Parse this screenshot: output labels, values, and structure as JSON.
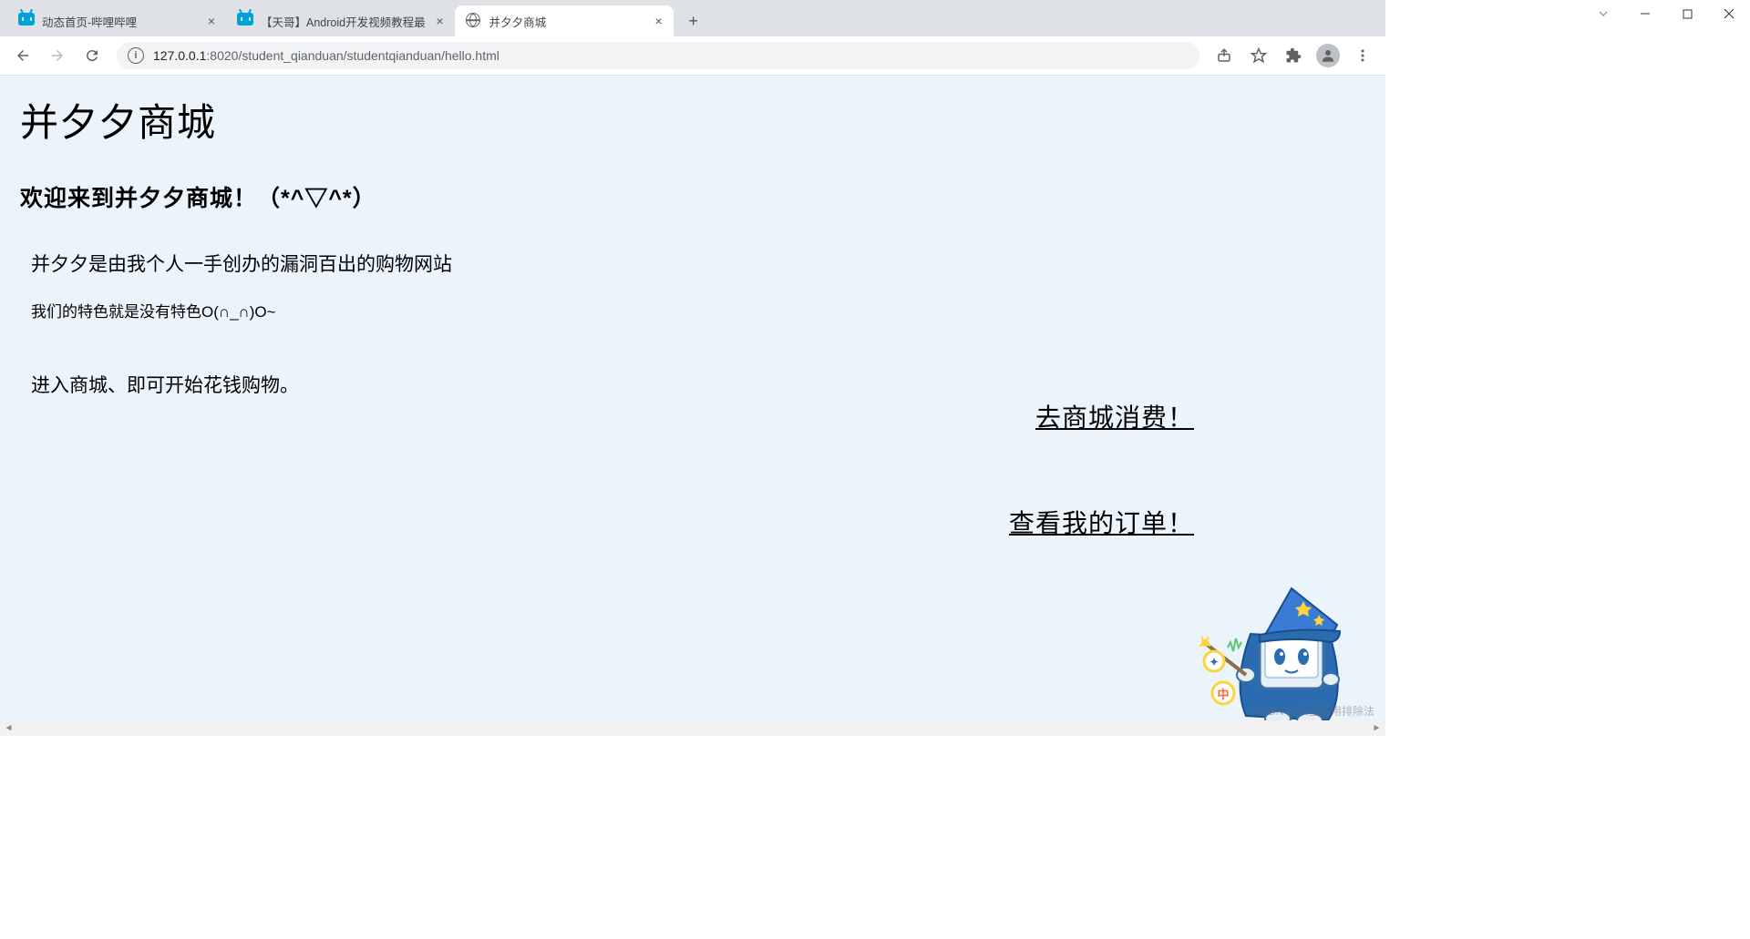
{
  "browser": {
    "tabs": [
      {
        "title": "动态首页-哔哩哔哩",
        "favicon": "bilibili",
        "active": false
      },
      {
        "title": "【天哥】Android开发视频教程最",
        "favicon": "bilibili",
        "active": false
      },
      {
        "title": "并夕夕商城",
        "favicon": "globe",
        "active": true
      }
    ],
    "url_host": "127.0.0.1",
    "url_port": ":8020",
    "url_path": "/student_qianduan/studentqianduan/hello.html"
  },
  "page": {
    "title": "并夕夕商城",
    "subtitle": "欢迎来到并夕夕商城！（*^▽^*）",
    "p1": "并夕夕是由我个人一手创办的漏洞百出的购物网站",
    "p2": "我们的特色就是没有特色O(∩_∩)O~",
    "p3": "进入商城、即可开始花钱购物。",
    "link1": "去商城消费！ ",
    "link2": "查看我的订单！ "
  },
  "watermark": "CSDN @人生要用排除法"
}
